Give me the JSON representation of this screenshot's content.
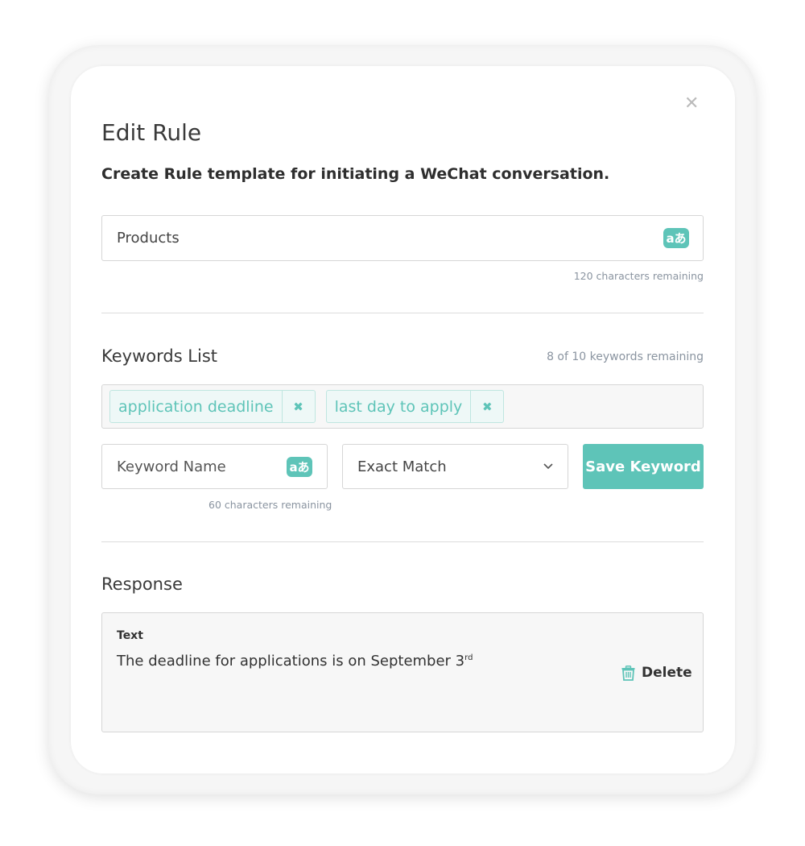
{
  "dialog": {
    "title": "Edit Rule",
    "subtitle": "Create Rule template for initiating a WeChat conversation.",
    "close_icon": "close-icon"
  },
  "rule_name": {
    "value": "Products",
    "remaining": "120 characters remaining",
    "translate_icon": "aあ"
  },
  "keywords": {
    "heading": "Keywords List",
    "remaining": "8 of 10 keywords remaining",
    "tags": [
      {
        "label": "application deadline"
      },
      {
        "label": "last day to apply"
      }
    ],
    "name_placeholder": "Keyword Name",
    "name_remaining": "60 characters remaining",
    "match_type": "Exact Match",
    "save_label": "Save Keyword"
  },
  "response": {
    "heading": "Response",
    "type_label": "Text",
    "text": "The deadline for applications is on September 3",
    "text_sup": "rd",
    "delete_label": "Delete"
  },
  "colors": {
    "accent": "#5ec4b8"
  }
}
